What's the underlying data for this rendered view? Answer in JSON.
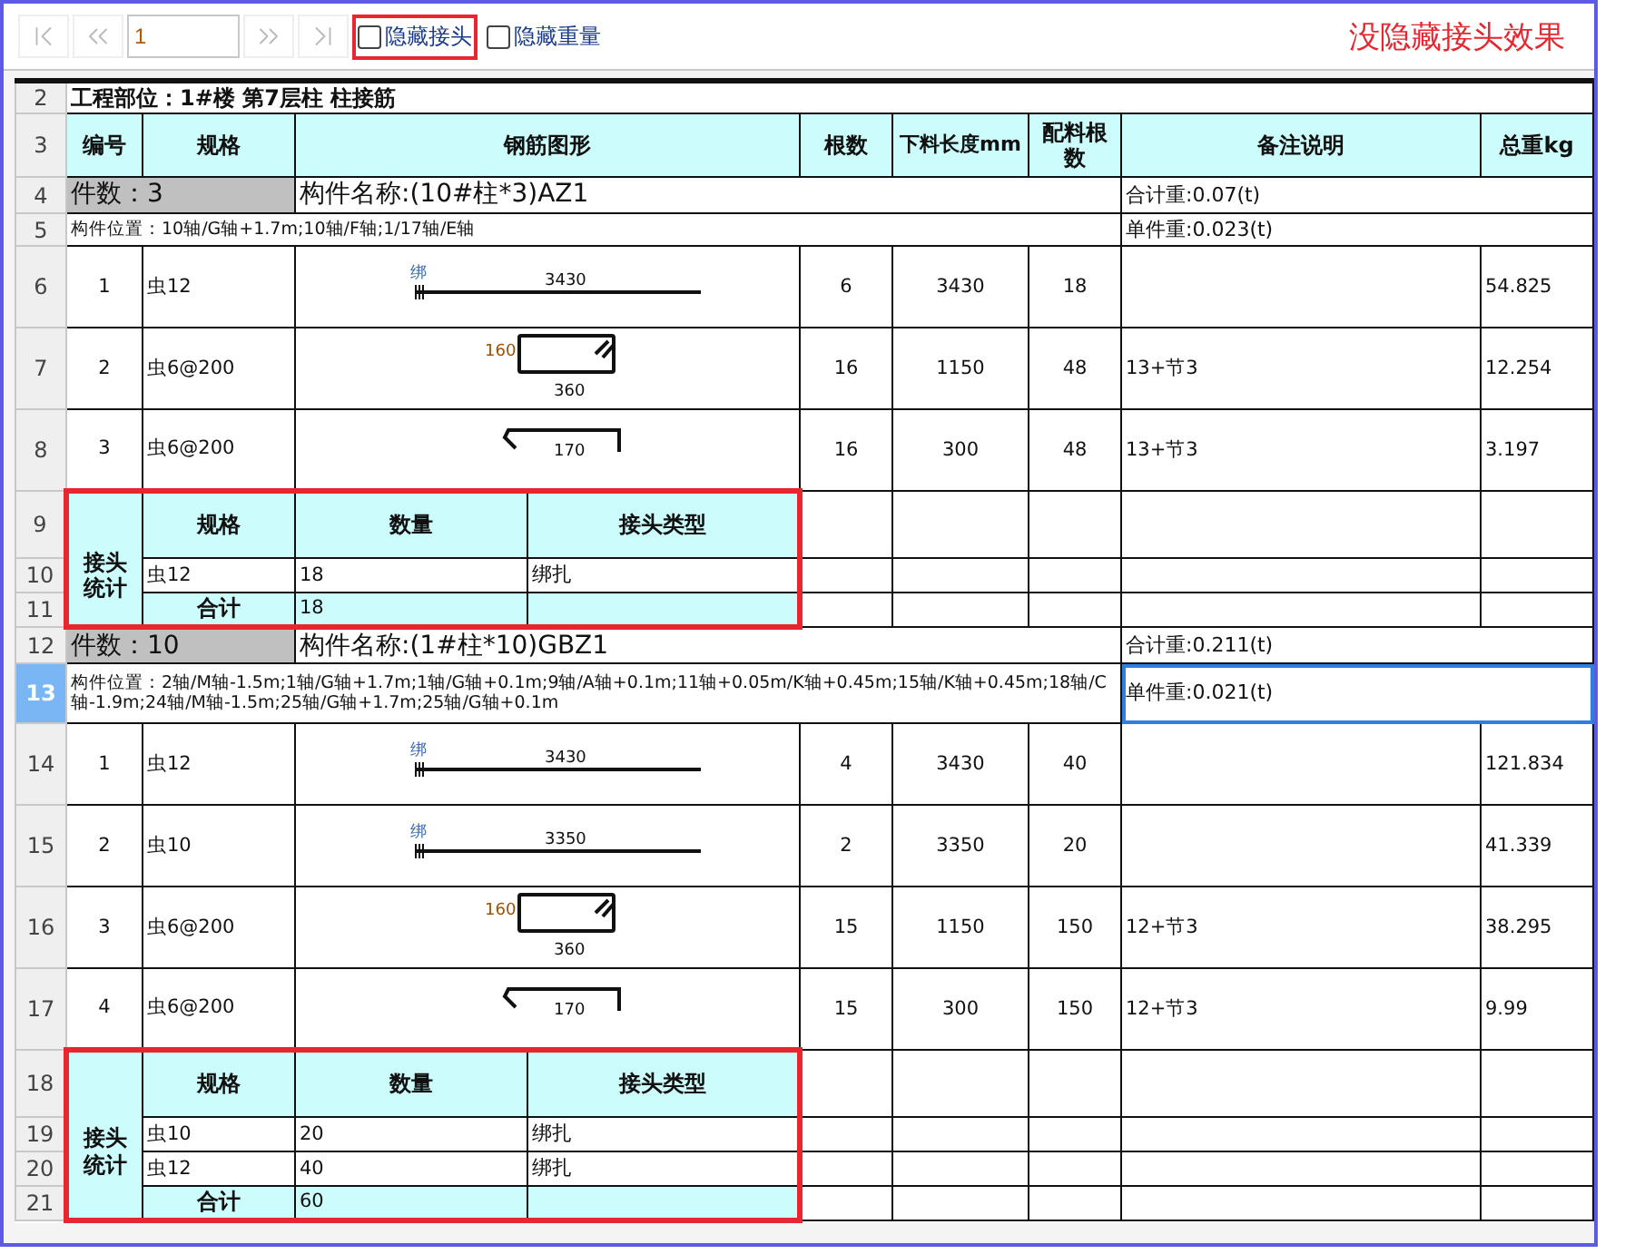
{
  "toolbar": {
    "nav_buttons": [
      {
        "kind": "first",
        "disabled": true
      },
      {
        "kind": "prev",
        "disabled": true
      },
      {
        "kind": "next",
        "disabled": true
      },
      {
        "kind": "last",
        "disabled": true
      }
    ],
    "page_input": "1",
    "checkboxes": [
      {
        "kind": "framed",
        "label": "隐藏接头",
        "checked": false
      },
      {
        "kind": "plain",
        "label": "隐藏重量",
        "checked": false
      }
    ],
    "annotation": "没隐藏接头效果"
  },
  "sheet": {
    "title": {
      "row": "2",
      "text": "工程部位：1#楼 第7层柱 柱接筋"
    },
    "header": {
      "row": "3",
      "columns": [
        "编号",
        "规格",
        "钢筋图形",
        "根数",
        "下料长度mm",
        "配料根数",
        "备注说明",
        "总重kg"
      ]
    },
    "components": [
      {
        "count_row": "4",
        "count": "件数：3",
        "name": "构件名称:(10#柱*3)AZ1",
        "total_weight": "合计重:0.07(t)",
        "position_row": "5",
        "position": "构件位置：10轴/G轴+1.7m;10轴/F轴;1/17轴/E轴",
        "unit_weight": "单件重:0.023(t)",
        "selected": false,
        "bars": [
          {
            "row": "6",
            "no": "1",
            "spec": "虫12",
            "shape": {
              "kind": "straight",
              "tie": "绑",
              "length": "3430"
            },
            "count": "6",
            "cut_length": "3430",
            "pieces": "18",
            "weight": "54.825"
          },
          {
            "row": "7",
            "no": "2",
            "spec": "虫6@200",
            "shape": {
              "kind": "stirrup",
              "side": "160",
              "length": "360"
            },
            "count": "16",
            "cut_length": "1150",
            "pieces": "48",
            "note": "13+节3",
            "weight": "12.254"
          },
          {
            "row": "8",
            "no": "3",
            "spec": "虫6@200",
            "shape": {
              "kind": "hook",
              "length": "170"
            },
            "count": "16",
            "cut_length": "300",
            "pieces": "48",
            "note": "13+节3",
            "weight": "3.197"
          }
        ],
        "joints": {
          "header_row": "9",
          "label": "接头统计",
          "columns": [
            "规格",
            "数量",
            "接头类型"
          ],
          "items": [
            {
              "row": "10",
              "spec": "虫12",
              "qty": "18",
              "type": "绑扎"
            }
          ],
          "total": {
            "row": "11",
            "label": "合计",
            "qty": "18"
          }
        }
      },
      {
        "count_row": "12",
        "count": "件数：10",
        "name": "构件名称:(1#柱*10)GBZ1",
        "total_weight": "合计重:0.211(t)",
        "position_row": "13",
        "position": "构件位置：2轴/M轴-1.5m;1轴/G轴+1.7m;1轴/G轴+0.1m;9轴/A轴+0.1m;11轴+0.05m/K轴+0.45m;15轴/K轴+0.45m;18轴/C轴-1.9m;24轴/M轴-1.5m;25轴/G轴+1.7m;25轴/G轴+0.1m",
        "unit_weight": "单件重:0.021(t)",
        "selected": true,
        "bars": [
          {
            "row": "14",
            "no": "1",
            "spec": "虫12",
            "shape": {
              "kind": "straight",
              "tie": "绑",
              "length": "3430"
            },
            "count": "4",
            "cut_length": "3430",
            "pieces": "40",
            "weight": "121.834"
          },
          {
            "row": "15",
            "no": "2",
            "spec": "虫10",
            "shape": {
              "kind": "straight",
              "tie": "绑",
              "length": "3350"
            },
            "count": "2",
            "cut_length": "3350",
            "pieces": "20",
            "weight": "41.339"
          },
          {
            "row": "16",
            "no": "3",
            "spec": "虫6@200",
            "shape": {
              "kind": "stirrup",
              "side": "160",
              "length": "360"
            },
            "count": "15",
            "cut_length": "1150",
            "pieces": "150",
            "note": "12+节3",
            "weight": "38.295"
          },
          {
            "row": "17",
            "no": "4",
            "spec": "虫6@200",
            "shape": {
              "kind": "hook",
              "length": "170"
            },
            "count": "15",
            "cut_length": "300",
            "pieces": "150",
            "note": "12+节3",
            "weight": "9.99"
          }
        ],
        "joints": {
          "header_row": "18",
          "label": "接头统计",
          "columns": [
            "规格",
            "数量",
            "接头类型"
          ],
          "items": [
            {
              "row": "19",
              "spec": "虫10",
              "qty": "20",
              "type": "绑扎"
            },
            {
              "row": "20",
              "spec": "虫12",
              "qty": "40",
              "type": "绑扎"
            }
          ],
          "total": {
            "row": "21",
            "label": "合计",
            "qty": "60"
          }
        }
      }
    ]
  }
}
